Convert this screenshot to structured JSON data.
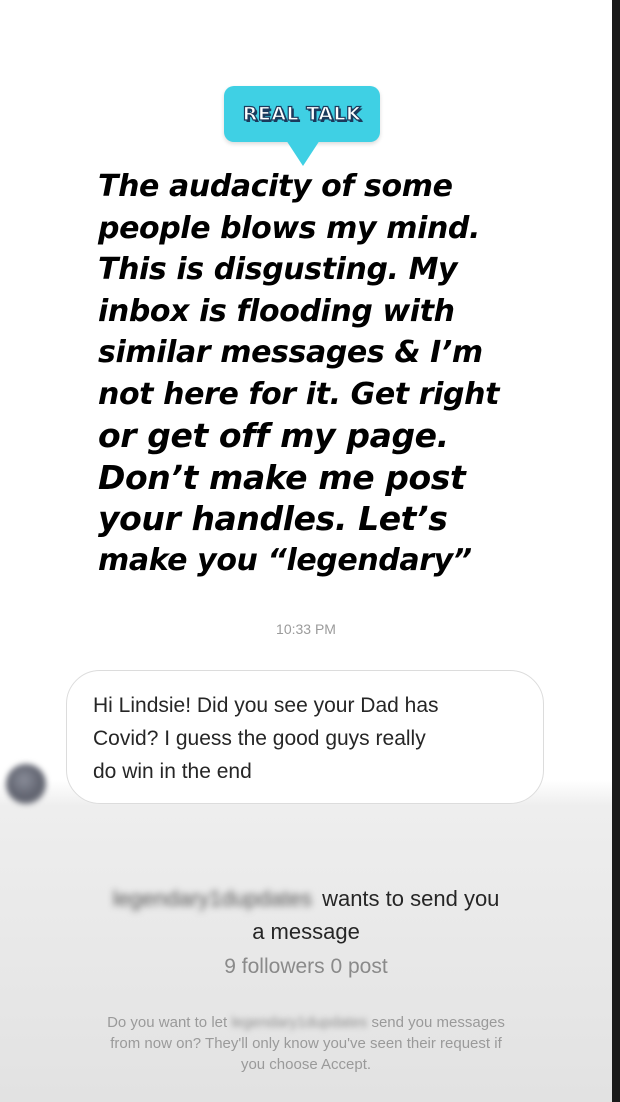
{
  "story": {
    "sticker_label": "REAL TALK",
    "caption_lines": [
      "The audacity of some",
      "people blows my mind.",
      "This is disgusting. My",
      "inbox is flooding with",
      "similar messages & I’m",
      "not here for it. Get right",
      "or get off my page.",
      "Don’t make me post",
      "your handles. Let’s",
      "make you “legendary”"
    ]
  },
  "thread": {
    "timestamp": "10:33 PM",
    "message_lines": [
      "Hi Lindsie! Did you see your Dad has",
      "Covid? I guess the good guys really",
      "do win in the end"
    ]
  },
  "request": {
    "sender_handle": "legendary1dupdates",
    "title_suffix": "wants to send you",
    "title_line2": "a message",
    "follower_stats": "9 followers 0 post",
    "info_prefix": "Do you want to let",
    "info_suffix": "send you messages",
    "info_line2": "from now on? They'll only know you've seen their request if",
    "info_line3": "you choose Accept."
  },
  "colors": {
    "sticker_bg": "#3fd0e4",
    "sticker_outline": "#1b3a5c",
    "timestamp": "#9b9b9b",
    "secondary_text": "#8a8a8a"
  }
}
